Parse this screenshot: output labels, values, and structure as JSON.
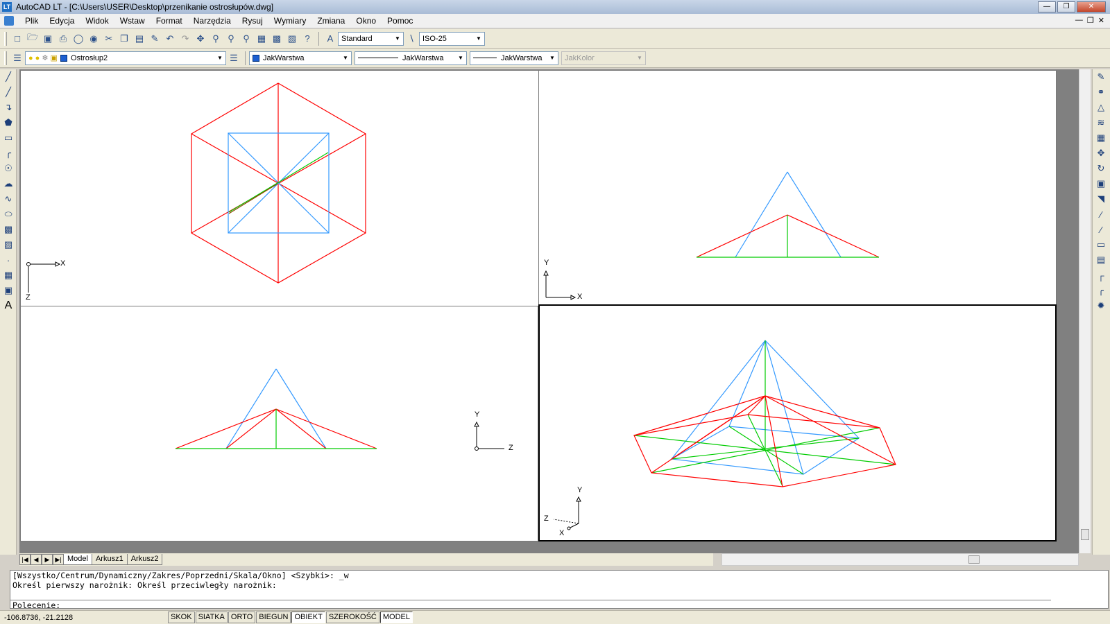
{
  "window": {
    "title": "AutoCAD LT - [C:\\Users\\USER\\Desktop\\przenikanie ostrosłupów.dwg]",
    "app_icon": "LT"
  },
  "menu": {
    "items": [
      "Plik",
      "Edycja",
      "Widok",
      "Wstaw",
      "Format",
      "Narzędzia",
      "Rysuj",
      "Wymiary",
      "Zmiana",
      "Okno",
      "Pomoc"
    ]
  },
  "toolbar1": {
    "text_style": "Standard",
    "dim_style": "ISO-25"
  },
  "toolbar2": {
    "layer": "Ostrosłup2",
    "color": "JakWarstwa",
    "linetype": "JakWarstwa",
    "lineweight": "JakWarstwa",
    "plotstyle": "JakKolor"
  },
  "viewports": {
    "top_left": {
      "ucs_x": "X",
      "ucs_y": "Z"
    },
    "top_right": {
      "ucs_x": "X",
      "ucs_y": "Y"
    },
    "bottom_left": {
      "ucs_x": "Z",
      "ucs_y": "Y"
    },
    "bottom_right": {
      "ucs_x": "X",
      "ucs_y": "Y",
      "ucs_z": "Z"
    }
  },
  "colors": {
    "red": "#ff0000",
    "blue": "#3399ff",
    "green": "#00cc00",
    "hidden_red": "#8a4a00"
  },
  "tabs": [
    "Model",
    "Arkusz1",
    "Arkusz2"
  ],
  "command": {
    "line1": "[Wszystko/Centrum/Dynamiczny/Zakres/Poprzedni/Skala/Okno] <Szybki>: _w",
    "line2": "Określ pierwszy narożnik: Określ przeciwległy narożnik:",
    "prompt": "Polecenie:"
  },
  "status": {
    "coords": "-106.8736, -21.2128",
    "buttons": [
      "SKOK",
      "SIATKA",
      "ORTO",
      "BIEGUN",
      "OBIEKT",
      "SZEROKOŚĆ",
      "MODEL"
    ],
    "active": [
      "OBIEKT",
      "MODEL"
    ]
  }
}
